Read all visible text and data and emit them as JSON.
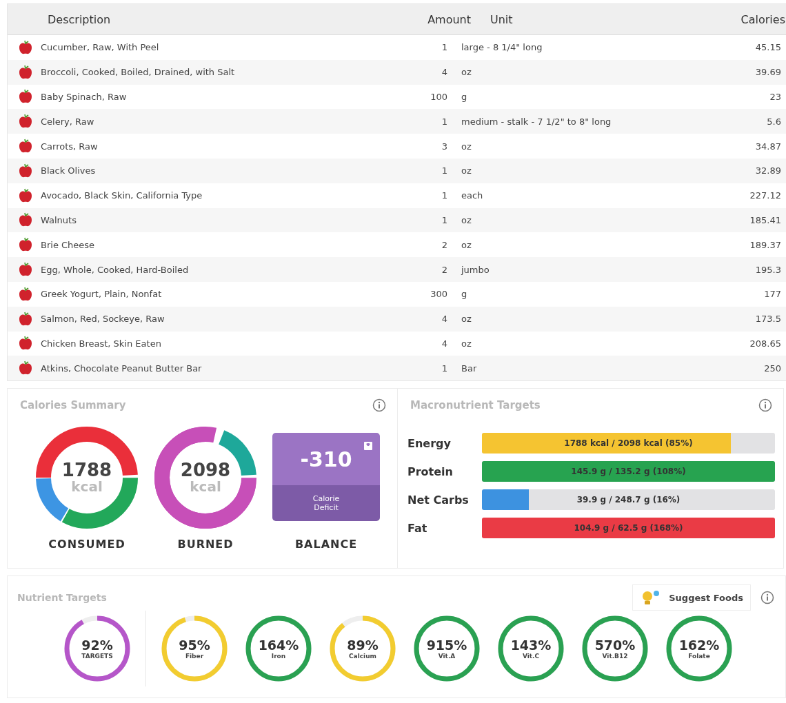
{
  "food_table": {
    "columns": [
      "Description",
      "Amount",
      "Unit",
      "Calories"
    ],
    "rows": [
      {
        "description": "Cucumber, Raw, With Peel",
        "amount": "1",
        "unit": "large - 8 1/4\" long",
        "calories": "45.15"
      },
      {
        "description": "Broccoli, Cooked, Boiled, Drained, with Salt",
        "amount": "4",
        "unit": "oz",
        "calories": "39.69"
      },
      {
        "description": "Baby Spinach, Raw",
        "amount": "100",
        "unit": "g",
        "calories": "23"
      },
      {
        "description": "Celery, Raw",
        "amount": "1",
        "unit": "medium - stalk - 7 1/2\" to 8\" long",
        "calories": "5.6"
      },
      {
        "description": "Carrots, Raw",
        "amount": "3",
        "unit": "oz",
        "calories": "34.87"
      },
      {
        "description": "Black Olives",
        "amount": "1",
        "unit": "oz",
        "calories": "32.89"
      },
      {
        "description": "Avocado, Black Skin, California Type",
        "amount": "1",
        "unit": "each",
        "calories": "227.12"
      },
      {
        "description": "Walnuts",
        "amount": "1",
        "unit": "oz",
        "calories": "185.41"
      },
      {
        "description": "Brie Cheese",
        "amount": "2",
        "unit": "oz",
        "calories": "189.37"
      },
      {
        "description": "Egg, Whole, Cooked, Hard-Boiled",
        "amount": "2",
        "unit": "jumbo",
        "calories": "195.3"
      },
      {
        "description": "Greek Yogurt, Plain, Nonfat",
        "amount": "300",
        "unit": "g",
        "calories": "177"
      },
      {
        "description": "Salmon, Red, Sockeye, Raw",
        "amount": "4",
        "unit": "oz",
        "calories": "173.5"
      },
      {
        "description": "Chicken Breast, Skin Eaten",
        "amount": "4",
        "unit": "oz",
        "calories": "208.65"
      },
      {
        "description": "Atkins, Chocolate Peanut Butter Bar",
        "amount": "1",
        "unit": "Bar",
        "calories": "250"
      }
    ]
  },
  "calories_summary": {
    "title": "Calories Summary",
    "consumed": {
      "value": "1788",
      "unit": "kcal",
      "label": "CONSUMED"
    },
    "burned": {
      "value": "2098",
      "unit": "kcal",
      "label": "BURNED"
    },
    "balance": {
      "value": "-310",
      "caption": "Calorie Deficit",
      "label": "BALANCE"
    }
  },
  "macronutrient_targets": {
    "title": "Macronutrient Targets",
    "bars": [
      {
        "name": "Energy",
        "reading": "1788 kcal / 2098 kcal (85%)",
        "level": 0.85,
        "color": "#f5c431"
      },
      {
        "name": "Protein",
        "reading": "145.9 g / 135.2 g (108%)",
        "level": 1,
        "color": "#27a350"
      },
      {
        "name": "Net Carbs",
        "reading": "39.9 g / 248.7 g (16%)",
        "level": 0.16,
        "color": "#3d92e0"
      },
      {
        "name": "Fat",
        "reading": "104.9 g / 62.5 g (168%)",
        "level": 1,
        "color": "#ea3b45"
      }
    ]
  },
  "nutrient_targets": {
    "title": "Nutrient Targets",
    "suggest_button": "Suggest Foods",
    "rings": [
      {
        "percent": "92%",
        "name": "TARGETS",
        "level": 0.92,
        "color": "#b556c9"
      },
      {
        "percent": "95%",
        "name": "Fiber",
        "level": 0.95,
        "color": "#f2cc30"
      },
      {
        "percent": "164%",
        "name": "Iron",
        "level": 1,
        "color": "#2aa152"
      },
      {
        "percent": "89%",
        "name": "Calcium",
        "level": 0.89,
        "color": "#f2cc30"
      },
      {
        "percent": "915%",
        "name": "Vit.A",
        "level": 1,
        "color": "#2aa152"
      },
      {
        "percent": "143%",
        "name": "Vit.C",
        "level": 1,
        "color": "#2aa152"
      },
      {
        "percent": "570%",
        "name": "Vit.B12",
        "level": 1,
        "color": "#2aa152"
      },
      {
        "percent": "162%",
        "name": "Folate",
        "level": 1,
        "color": "#2aa152"
      }
    ]
  }
}
